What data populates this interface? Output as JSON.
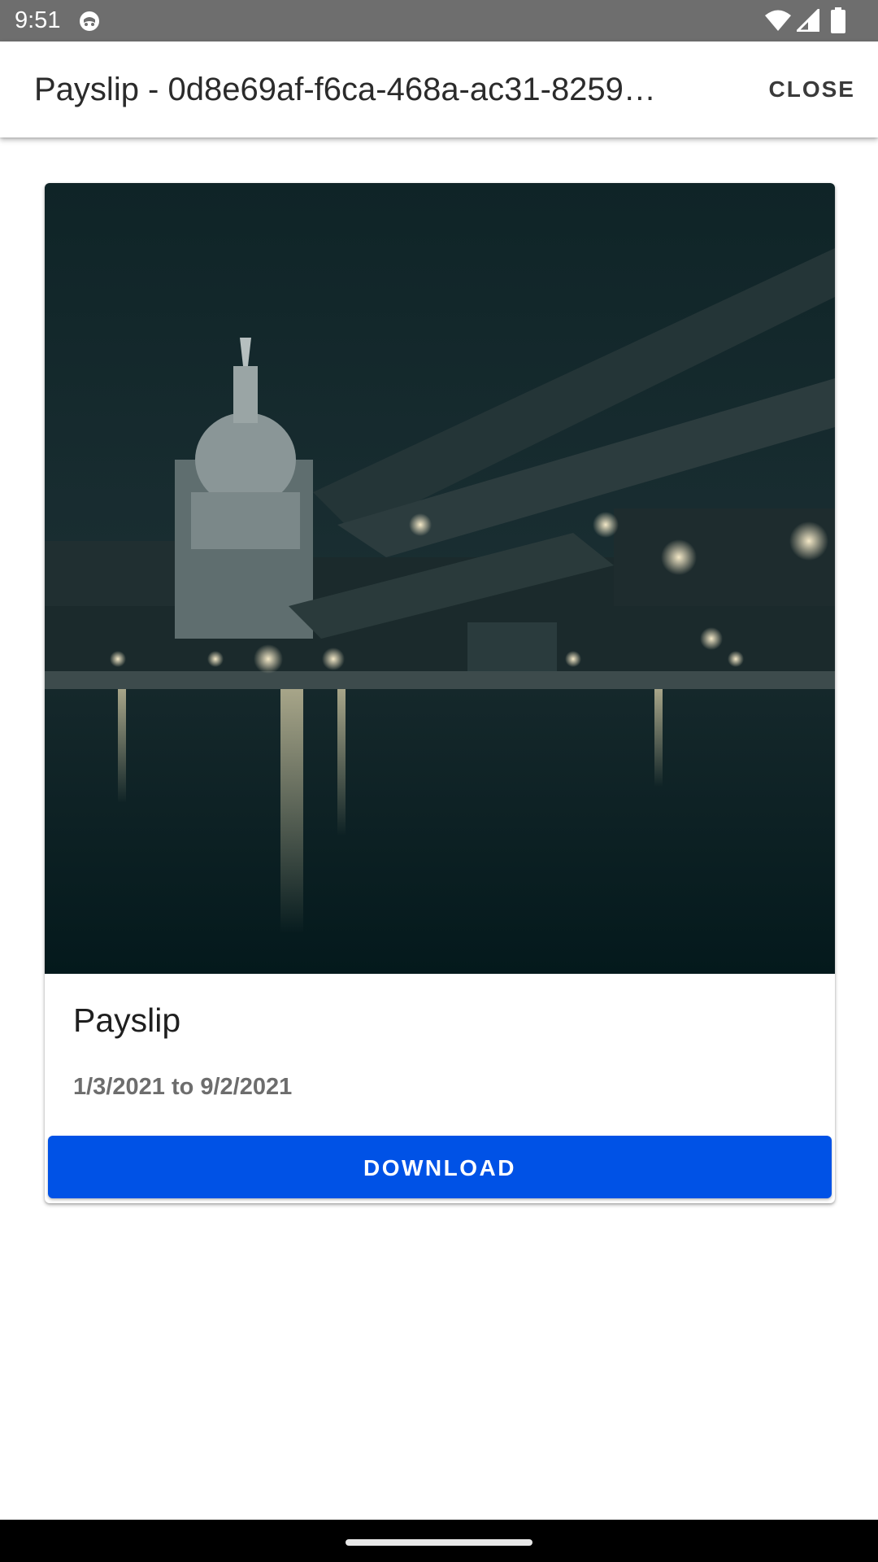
{
  "status_bar": {
    "time": "9:51",
    "icons": [
      "app-notification-icon",
      "wifi-icon",
      "cellular-signal-icon",
      "battery-icon"
    ],
    "background_color": "#6e6e6e"
  },
  "app_bar": {
    "title": "Payslip - 0d8e69af-f6ca-468a-ac31-8259…",
    "close_label": "CLOSE"
  },
  "card": {
    "image_icon": "city-night-photo",
    "title": "Payslip",
    "date_range": "1/3/2021 to 9/2/2021",
    "download_label": "DOWNLOAD",
    "accent_color": "#0052e6"
  }
}
